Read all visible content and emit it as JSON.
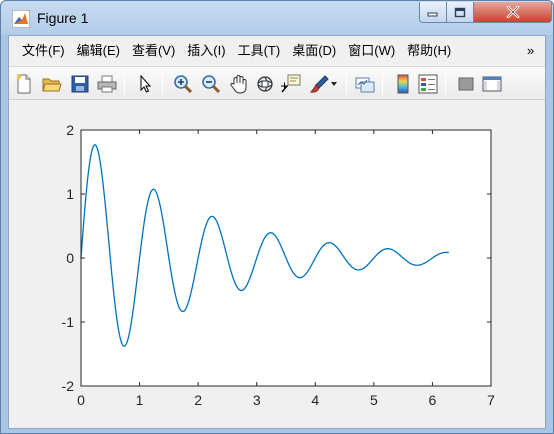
{
  "window": {
    "title": "Figure 1",
    "icons": {
      "app": "matlab-logo-icon",
      "minimize": "minimize-icon",
      "maximize": "maximize-icon",
      "close": "close-icon"
    }
  },
  "menubar": {
    "items": [
      {
        "label": "文件(F)"
      },
      {
        "label": "编辑(E)"
      },
      {
        "label": "查看(V)"
      },
      {
        "label": "插入(I)"
      },
      {
        "label": "工具(T)"
      },
      {
        "label": "桌面(D)"
      },
      {
        "label": "窗口(W)"
      },
      {
        "label": "帮助(H)"
      }
    ],
    "overflow_glyph": "»"
  },
  "toolbar": {
    "buttons": [
      {
        "icon": "new-figure-icon"
      },
      {
        "icon": "open-file-icon"
      },
      {
        "icon": "save-icon"
      },
      {
        "icon": "print-icon"
      },
      {
        "icon": "select-arrow-icon"
      },
      {
        "icon": "zoom-in-icon"
      },
      {
        "icon": "zoom-out-icon"
      },
      {
        "icon": "pan-hand-icon"
      },
      {
        "icon": "rotate-3d-icon"
      },
      {
        "icon": "data-cursor-icon"
      },
      {
        "icon": "brush-icon"
      },
      {
        "icon": "brush-dropdown-icon"
      },
      {
        "icon": "link-plot-icon"
      },
      {
        "icon": "colorbar-icon"
      },
      {
        "icon": "legend-icon"
      },
      {
        "icon": "hide-plot-tools-icon"
      },
      {
        "icon": "show-plot-tools-icon"
      }
    ]
  },
  "colors": {
    "line": "#0072bd",
    "axes_bg": "#ffffff",
    "figure_bg": "#f0f0f0"
  },
  "chart_data": {
    "type": "line",
    "title": "",
    "xlabel": "",
    "ylabel": "",
    "xlim": [
      0,
      7
    ],
    "ylim": [
      -2,
      2
    ],
    "x_ticks": [
      "0",
      "1",
      "2",
      "3",
      "4",
      "5",
      "6",
      "7"
    ],
    "y_ticks": [
      "-2",
      "-1",
      "0",
      "1",
      "2"
    ],
    "grid": false,
    "legend": "none",
    "series": [
      {
        "function": "y = 2*exp(-0.5*x)*sin(2*pi*x)",
        "x_range": [
          0,
          6.28
        ],
        "peaks": [
          [
            0.24,
            1.76
          ],
          [
            0.74,
            -1.37
          ],
          [
            1.24,
            1.07
          ],
          [
            1.74,
            -0.83
          ],
          [
            2.24,
            0.65
          ],
          [
            2.74,
            -0.5
          ],
          [
            3.24,
            0.39
          ],
          [
            3.74,
            -0.3
          ],
          [
            4.24,
            0.24
          ],
          [
            4.74,
            -0.18
          ],
          [
            5.24,
            0.14
          ],
          [
            5.74,
            -0.11
          ]
        ],
        "end_point": [
          6.28,
          0.08
        ]
      }
    ]
  }
}
